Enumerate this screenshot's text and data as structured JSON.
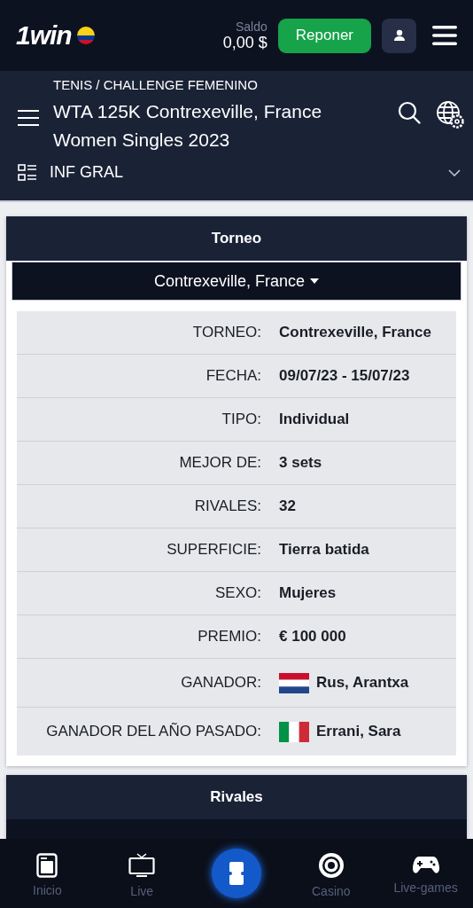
{
  "header": {
    "logo": "1win",
    "balance_label": "Saldo",
    "balance": "0,00 $",
    "deposit_button": "Reponer"
  },
  "subheader": {
    "breadcrumb": "TENIS / CHALLENGE FEMENINO",
    "title": "WTA 125K Contrexeville, France Women Singles 2023",
    "section": "INF GRAL"
  },
  "tournament_card": {
    "title": "Torneo",
    "dropdown": "Contrexeville, France",
    "rows": [
      {
        "label": "TORNEO:",
        "value": "Contrexeville, France"
      },
      {
        "label": "FECHA:",
        "value": "09/07/23 - 15/07/23"
      },
      {
        "label": "TIPO:",
        "value": "Individual"
      },
      {
        "label": "MEJOR DE:",
        "value": "3 sets"
      },
      {
        "label": "RIVALES:",
        "value": "32"
      },
      {
        "label": "SUPERFICIE:",
        "value": "Tierra batida"
      },
      {
        "label": "SEXO:",
        "value": "Mujeres"
      },
      {
        "label": "PREMIO:",
        "value": "€ 100 000"
      },
      {
        "label": "GANADOR:",
        "value": "Rus, Arantxa",
        "kind": "flag_nl"
      },
      {
        "label": "GANADOR DEL AÑO PASADO:",
        "value": "Errani, Sara",
        "kind": "flag_it"
      }
    ]
  },
  "rivals_card": {
    "title": "Rivales"
  },
  "bottom_nav": [
    {
      "label": "Inicio",
      "kind": "home"
    },
    {
      "label": "Live",
      "kind": "tv"
    },
    {
      "kind": "coupon"
    },
    {
      "label": "Casino",
      "kind": "chip"
    },
    {
      "label": "Live-games",
      "kind": "gamepad"
    }
  ]
}
